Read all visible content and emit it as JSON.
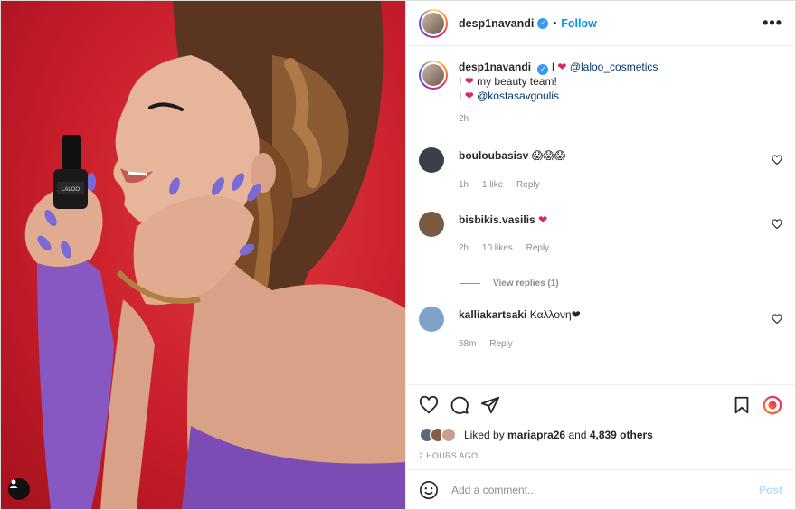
{
  "header": {
    "username": "desp1navandi",
    "verified_glyph": "✓",
    "separator": "•",
    "follow_label": "Follow",
    "more_label": "•••"
  },
  "caption": {
    "username": "desp1navandi",
    "line1_pipe": "I",
    "line1_mention": "@laloo_cosmetics",
    "line2_pipe": "I",
    "line2_text": "my beauty team!",
    "line3_pipe": "I",
    "line3_mention": "@kostasavgoulis",
    "heart": "❤",
    "time": "2h"
  },
  "comments": [
    {
      "username": "bouloubasisv",
      "text": "😱😱😱",
      "time": "1h",
      "likes": "1 like",
      "reply": "Reply",
      "avatar_color": "#3a3f4a"
    },
    {
      "username": "bisbikis.vasilis",
      "text": "❤",
      "time": "2h",
      "likes": "10 likes",
      "reply": "Reply",
      "avatar_color": "#7a5a40"
    },
    {
      "username": "kalliakartsaki",
      "text": "Καλλονη❤",
      "time": "58m",
      "reply": "Reply",
      "avatar_color": "#7fa3c8"
    }
  ],
  "view_replies": "View replies (1)",
  "likes": {
    "prefix": "Liked by",
    "user": "mariapra26",
    "and": "and",
    "others": "4,839 others"
  },
  "posted_ago": "2 HOURS AGO",
  "add_comment": {
    "placeholder": "Add a comment...",
    "post_label": "Post"
  },
  "icons": {
    "like": "heart-icon",
    "comment": "comment-icon",
    "share": "send-icon",
    "save": "bookmark-icon",
    "emoji": "emoji-icon",
    "tag": "user-tag-icon",
    "more": "more-icon"
  },
  "colors": {
    "accent_blue": "#0095f6",
    "mention": "#00376b",
    "heart_red": "#e0245e",
    "muted": "#8e8e8e",
    "photo_bg": "#c81e2a"
  }
}
